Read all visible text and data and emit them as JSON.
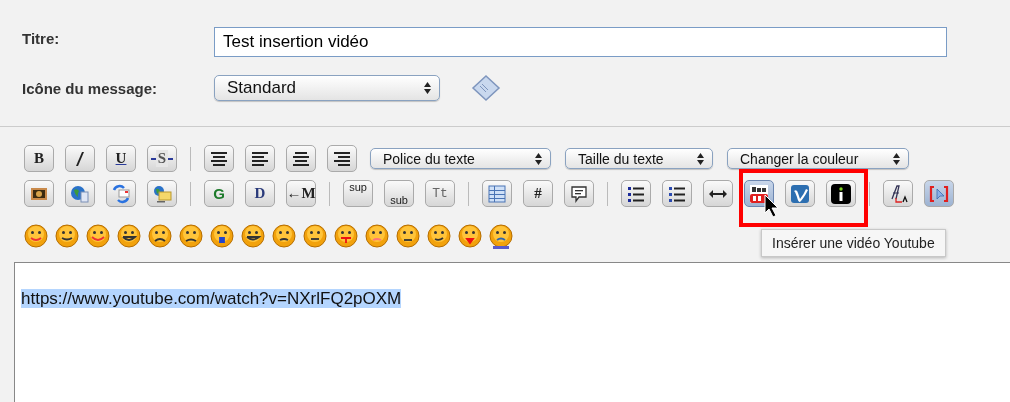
{
  "form": {
    "title_label": "Titre:",
    "title_value": "Test insertion vidéo",
    "icon_label": "Icône du message:",
    "icon_value": "Standard"
  },
  "toolbar": {
    "row_1": [
      {
        "kind": "text",
        "label": "B",
        "pressed": false
      },
      {
        "kind": "icon",
        "pressed": false
      },
      {
        "kind": "text",
        "label": "U",
        "pressed": false
      },
      {
        "kind": "text",
        "label": "S",
        "pressed": false
      },
      {
        "kind": "separator"
      },
      {
        "kind": "icon",
        "pressed": false
      },
      {
        "kind": "icon",
        "pressed": false
      },
      {
        "kind": "icon",
        "pressed": false
      },
      {
        "kind": "icon",
        "pressed": false
      },
      {
        "kind": "select",
        "label": "Police du texte"
      },
      {
        "kind": "select",
        "label": "Taille du texte"
      },
      {
        "kind": "select",
        "label": "Changer la couleur"
      }
    ],
    "row_2": [
      {
        "kind": "icon",
        "pressed": false
      },
      {
        "kind": "icon",
        "pressed": false
      },
      {
        "kind": "icon",
        "pressed": false
      },
      {
        "kind": "icon",
        "pressed": false
      },
      {
        "kind": "separator"
      },
      {
        "kind": "text",
        "label": "G",
        "pressed": false
      },
      {
        "kind": "text",
        "label": "D",
        "pressed": false
      },
      {
        "kind": "text",
        "label": "←M",
        "pressed": false
      },
      {
        "kind": "separator"
      },
      {
        "kind": "text",
        "label": "sup",
        "pressed": false
      },
      {
        "kind": "text",
        "label": "sub",
        "pressed": false
      },
      {
        "kind": "text",
        "label": "Tt",
        "pressed": false
      },
      {
        "kind": "separator"
      },
      {
        "kind": "icon",
        "pressed": false
      },
      {
        "kind": "text",
        "label": "#",
        "pressed": false
      },
      {
        "kind": "icon",
        "pressed": false
      },
      {
        "kind": "separator"
      },
      {
        "kind": "icon",
        "pressed": false
      },
      {
        "kind": "icon",
        "pressed": false
      },
      {
        "kind": "icon",
        "pressed": false
      },
      {
        "kind": "video",
        "pressed": true,
        "hovered": true
      },
      {
        "kind": "video",
        "pressed": false,
        "hovered": false
      },
      {
        "kind": "video",
        "pressed": false,
        "hovered": false
      },
      {
        "kind": "separator"
      },
      {
        "kind": "icon",
        "pressed": false
      },
      {
        "kind": "icon",
        "pressed": true
      }
    ]
  },
  "tooltip": "Insérer une vidéo Youtube",
  "editor": {
    "text": "https://www.youtube.com/watch?v=NXrlFQ2pOXM",
    "selected": true
  }
}
